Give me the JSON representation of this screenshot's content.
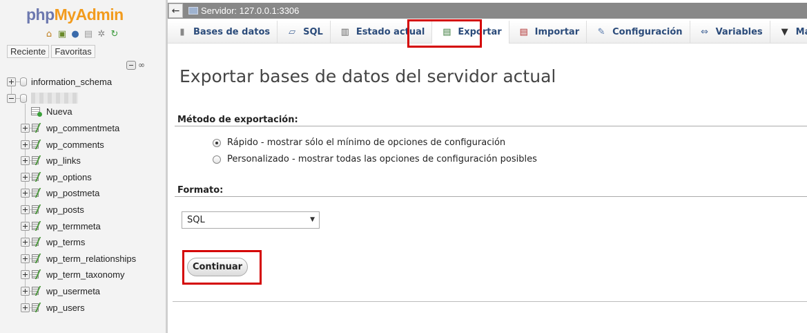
{
  "app": {
    "logo_php": "php",
    "logo_myadmin": "MyAdmin",
    "brand_colors": {
      "php": "#6c78af",
      "myadmin": "#f29b1d"
    }
  },
  "nav": {
    "icons": [
      "home-icon",
      "logout-icon",
      "help-icon",
      "docs-icon",
      "settings-icon",
      "reload-icon"
    ],
    "tabs": {
      "recent": "Reciente",
      "favorites": "Favoritas"
    },
    "databases": [
      {
        "name": "information_schema",
        "expanded": false
      },
      {
        "name": "",
        "expanded": true,
        "name_obscured": true
      }
    ],
    "new_label": "Nueva",
    "tables": [
      "wp_commentmeta",
      "wp_comments",
      "wp_links",
      "wp_options",
      "wp_postmeta",
      "wp_posts",
      "wp_termmeta",
      "wp_terms",
      "wp_term_relationships",
      "wp_term_taxonomy",
      "wp_usermeta",
      "wp_users"
    ]
  },
  "topbar": {
    "back_label": "←",
    "server_label": "Servidor: 127.0.0.1:3306"
  },
  "tabs": [
    {
      "label": "Bases de datos",
      "icon": "database-icon",
      "active": false
    },
    {
      "label": "SQL",
      "icon": "sql-icon",
      "active": false
    },
    {
      "label": "Estado actual",
      "icon": "status-chart-icon",
      "active": false
    },
    {
      "label": "Exportar",
      "icon": "export-icon",
      "active": true,
      "highlighted": true
    },
    {
      "label": "Importar",
      "icon": "import-icon",
      "active": false
    },
    {
      "label": "Configuración",
      "icon": "wrench-icon",
      "active": false
    },
    {
      "label": "Variables",
      "icon": "variables-icon",
      "active": false
    },
    {
      "label": "Más",
      "icon": "chevron-down-icon",
      "active": false
    }
  ],
  "main": {
    "title": "Exportar bases de datos del servidor actual",
    "method_heading": "Método de exportación:",
    "method_options": [
      {
        "label": "Rápido - mostrar sólo el mínimo de opciones de configuración",
        "checked": true
      },
      {
        "label": "Personalizado - mostrar todas las opciones de configuración posibles",
        "checked": false
      }
    ],
    "format_heading": "Formato:",
    "format_value": "SQL",
    "continue_label": "Continuar",
    "highlight_color": "#d40000"
  }
}
